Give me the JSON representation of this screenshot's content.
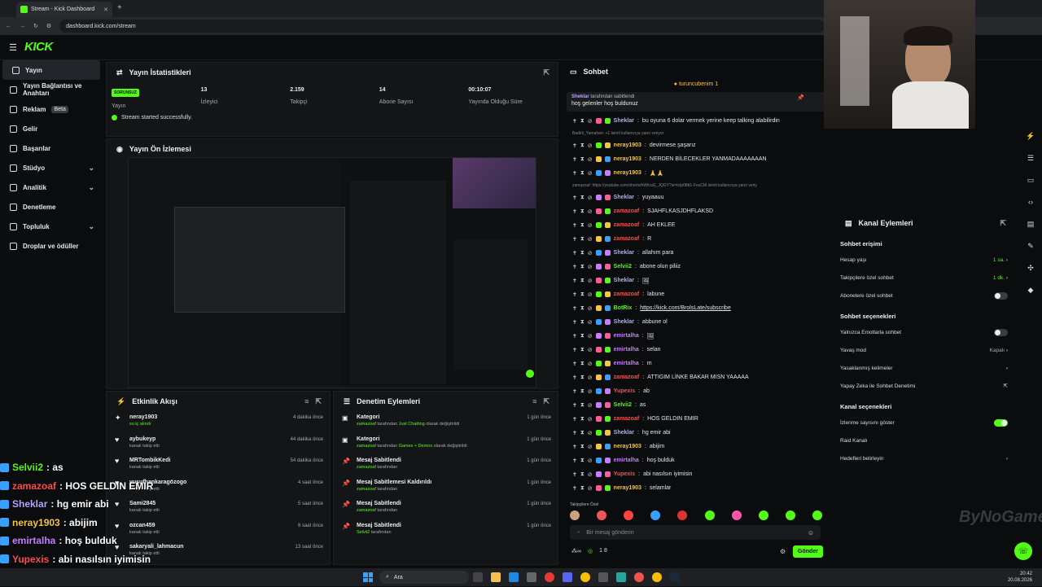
{
  "browser": {
    "tab_title": "Stream - Kick Dashboard",
    "url": "dashboard.kick.com/stream",
    "new_tab": "+"
  },
  "brand": {
    "logo": "KICK",
    "colors": {
      "accent": "#53fc18",
      "bg": "#0b0c0e",
      "panel": "#141517"
    }
  },
  "sidebar": {
    "items": [
      {
        "label": "Yayın",
        "icon": "broadcast-icon",
        "active": true
      },
      {
        "label": "Yayın Bağlantısı ve Anahtarı",
        "icon": "link-icon"
      },
      {
        "label": "Reklam",
        "icon": "ad-icon",
        "badge": "Beta"
      },
      {
        "label": "Gelir",
        "icon": "wallet-icon"
      },
      {
        "label": "Başarılar",
        "icon": "trophy-icon"
      },
      {
        "label": "Stüdyo",
        "icon": "studio-icon",
        "expandable": true
      },
      {
        "label": "Analitik",
        "icon": "chart-icon",
        "expandable": true
      },
      {
        "label": "Denetleme",
        "icon": "shield-icon"
      },
      {
        "label": "Topluluk",
        "icon": "people-icon",
        "expandable": true
      },
      {
        "label": "Droplar ve ödüller",
        "icon": "gift-icon"
      }
    ]
  },
  "stats": {
    "title": "Yayın İstatistikleri",
    "items": [
      {
        "value": "SORUNSUZ",
        "label": "Yayın"
      },
      {
        "value": "13",
        "label": "İzleyici"
      },
      {
        "value": "2.159",
        "label": "Takipçi"
      },
      {
        "value": "14",
        "label": "Abone Sayısı"
      },
      {
        "value": "00:10:07",
        "label": "Yayında Olduğu Süre"
      }
    ],
    "status": "Stream started successfully."
  },
  "preview": {
    "title": "Yayın Ön İzlemesi"
  },
  "activity": {
    "title": "Etkinlik Akışı",
    "items": [
      {
        "name": "neray1903",
        "sub": "sub",
        "sub_text": "su iç alındı",
        "time": "4 dakika önce"
      },
      {
        "name": "aybukeyp",
        "sub_text": "kanalı takip etti",
        "time": "44 dakika önce"
      },
      {
        "name": "MRTombikKedi",
        "sub_text": "kanalı takip etti",
        "time": "54 dakika önce"
      },
      {
        "name": "yusufhankaragözogo",
        "sub_text": "kanalı takip etti",
        "time": "4 saat önce"
      },
      {
        "name": "Sami2845",
        "sub_text": "kanalı takip etti",
        "time": "5 saat önce"
      },
      {
        "name": "ozcan459",
        "sub_text": "kanalı takip etti",
        "time": "6 saat önce"
      },
      {
        "name": "sakaryali_lahmacun",
        "sub_text": "kanalı takip etti",
        "time": "13 saat önce"
      }
    ]
  },
  "mod": {
    "title": "Denetim Eylemleri",
    "items": [
      {
        "name": "Kategori",
        "by": "zamazoaf",
        "mid": " tarafından ",
        "hl": "Just Chatting",
        "tail": " olarak değiştirildi",
        "time": "1 gün önce"
      },
      {
        "name": "Kategori",
        "by": "zamazoaf",
        "mid": " tarafından ",
        "hl": "Games + Demos",
        "tail": " olarak değiştirildi",
        "time": "1 gün önce"
      },
      {
        "name": "Mesaj Sabitlendi",
        "by": "zamazoaf",
        "mid": " tarafından",
        "hl": "",
        "tail": "",
        "time": "1 gün önce"
      },
      {
        "name": "Mesaj Sabitlemesi Kaldırıldı",
        "by": "zamazoaf",
        "mid": " tarafından",
        "hl": "",
        "tail": "",
        "time": "1 gün önce"
      },
      {
        "name": "Mesaj Sabitlendi",
        "by": "zamazoaf",
        "mid": " tarafından",
        "hl": "",
        "tail": "",
        "time": "1 gün önce"
      },
      {
        "name": "Mesaj Sabitlendi",
        "by": "Selvii2",
        "mid": " tarafından",
        "hl": "",
        "tail": "",
        "time": "1 gün önce"
      }
    ]
  },
  "chat": {
    "title": "Sohbet",
    "top_user": "turuncubenim 1",
    "pinned_by": "Sheklar",
    "pinned_label": " tarafından sabitlendi",
    "pinned_msg": "hoş gelenler hoş buldunuz",
    "sys1": "Badirli_Yamahan: +1 isimli kullanıcıya yanıt veriyor",
    "sys2": "zamazoaf: https://youtube.com/shorts/hWfcuG_JQGY?si=tclp08tt1-FouCM isimli kullanıcıya yanıt veriy",
    "messages": [
      {
        "user": "Sheklar",
        "color": "#b6a6ff",
        "text": "bu oyuna 6 dolar vermek yerine keep talking alabilirdin"
      },
      {
        "user": "neray1903",
        "color": "#f5c542",
        "text": "devirmese şaşarız"
      },
      {
        "user": "neray1903",
        "color": "#f5c542",
        "text": "NERDEN BİLECEKLER YANMADAAAAAAAN"
      },
      {
        "user": "neray1903",
        "color": "#f5c542",
        "text": "🙏🙏"
      },
      {
        "user": "Sheklar",
        "color": "#b6a6ff",
        "text": "yuyaauu"
      },
      {
        "user": "zamazoaf",
        "color": "#ff4d4d",
        "text": "SJAHFLKASJDHFLAKSD"
      },
      {
        "user": "zamazoaf",
        "color": "#ff4d4d",
        "text": "AH EKLEE"
      },
      {
        "user": "zamazoaf",
        "color": "#ff4d4d",
        "text": "R"
      },
      {
        "user": "Sheklar",
        "color": "#b6a6ff",
        "text": "allahım para"
      },
      {
        "user": "Selvii2",
        "color": "#53fc18",
        "text": "abone olun piliiz"
      },
      {
        "user": "Sheklar",
        "color": "#b6a6ff",
        "text": "🖼"
      },
      {
        "user": "zamazoaf",
        "color": "#ff4d4d",
        "text": "labune"
      },
      {
        "user": "BotRix",
        "color": "#53fc18",
        "text": "https://kick.com/BrolsLate/subscribe"
      },
      {
        "user": "Sheklar",
        "color": "#b6a6ff",
        "text": "abbune ol"
      },
      {
        "user": "emirtalha",
        "color": "#c77dff",
        "text": "🖼"
      },
      {
        "user": "emirtalha",
        "color": "#c77dff",
        "text": "selan"
      },
      {
        "user": "emirtalha",
        "color": "#c77dff",
        "text": "m"
      },
      {
        "user": "zamazoaf",
        "color": "#ff4d4d",
        "text": "ATTIGIM LİNKE BAKAR MISN YAAAAA"
      },
      {
        "user": "Yupexis",
        "color": "#ff4d4d",
        "text": "ab"
      },
      {
        "user": "Selvii2",
        "color": "#53fc18",
        "text": "as"
      },
      {
        "user": "zamazoaf",
        "color": "#ff4d4d",
        "text": "HOS GELDIN EMIR"
      },
      {
        "user": "Sheklar",
        "color": "#b6a6ff",
        "text": "hg emir abi"
      },
      {
        "user": "neray1903",
        "color": "#f5c542",
        "text": "abijim"
      },
      {
        "user": "emirtalha",
        "color": "#c77dff",
        "text": "hoş bulduk"
      },
      {
        "user": "Yupexis",
        "color": "#ff4d4d",
        "text": "abi nasılsın iyimisin"
      },
      {
        "user": "neray1903",
        "color": "#f5c542",
        "text": "selamlar"
      }
    ],
    "emote_label": "Takipçilere Özel",
    "input_placeholder": "Bir mesaj gönderin",
    "points": "1 8",
    "send": "Gönder"
  },
  "kanal": {
    "title": "Kanal Eylemleri",
    "sec1": "Sohbet erişimi",
    "hesap": "Hesap yaşı",
    "hesap_v": "1 sa.",
    "takip": "Takipçilere özel sohbet",
    "takip_v": "1 dk.",
    "abone": "Abonelere özel sohbet",
    "sec2": "Sohbet seçenekleri",
    "emote": "Yalnızca Emotlarla sohbet",
    "yavas": "Yavaş mod",
    "yavas_v": "Kapalı",
    "yasak": "Yasaklanmış kelimeler",
    "ai": "Yapay Zeka ile Sohbet Denetimi",
    "sec3": "Kanal seçenekleri",
    "izlenme": "İzlenme sayısını göster",
    "raid": "Raid Kanalı",
    "hedef": "Hedefleri belirleyin"
  },
  "overlay": [
    {
      "user": "Selvii2",
      "color": "#53fc18",
      "text": ": as"
    },
    {
      "user": "zamazoaf",
      "color": "#ff4d4d",
      "text": ": HOS GELDIN EMIR"
    },
    {
      "user": "Sheklar",
      "color": "#b6a6ff",
      "text": ": hg emir abi"
    },
    {
      "user": "neray1903",
      "color": "#f5c542",
      "text": ": abijim"
    },
    {
      "user": "emirtalha",
      "color": "#c77dff",
      "text": ": hoş bulduk"
    },
    {
      "user": "Yupexis",
      "color": "#ff4d4d",
      "text": ": abi nasılsın iyimisin"
    },
    {
      "user": "neray1903",
      "color": "#f5c542",
      "text": ": selamlar"
    }
  ],
  "watermark": "ByNoGame",
  "taskbar": {
    "search": "Ara",
    "time": "20:42",
    "date": "20.08.2026"
  }
}
